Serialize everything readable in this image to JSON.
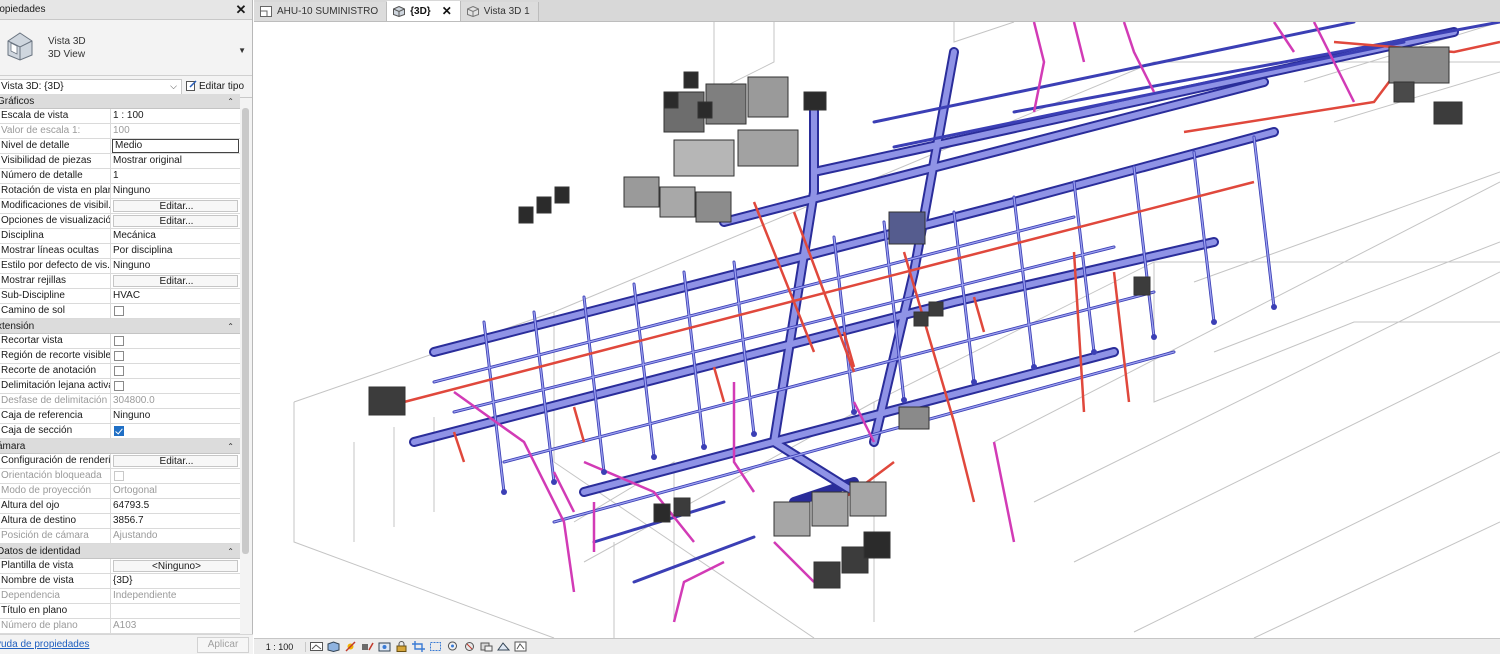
{
  "panel": {
    "title": "ropiedades",
    "type_name_line1": "Vista 3D",
    "type_name_line2": "3D View",
    "selector_value": "Vista 3D: {3D}",
    "edit_type_label": "Editar tipo",
    "help_link": "yuda de propiedades",
    "apply_label": "Aplicar"
  },
  "categories": {
    "graficos": "Gráficos",
    "extension": "xtensión",
    "camara": "ámara",
    "identidad": "Datos de identidad"
  },
  "rows": {
    "escala_k": "Escala de vista",
    "escala_v": "1 : 100",
    "valor_escala_k": "Valor de escala    1:",
    "valor_escala_v": "100",
    "nivel_k": "Nivel de detalle",
    "nivel_v": "Medio",
    "visibilidad_k": "Visibilidad de piezas",
    "visibilidad_v": "Mostrar original",
    "numero_detalle_k": "Número de detalle",
    "numero_detalle_v": "1",
    "rotacion_k": "Rotación de vista en plano",
    "rotacion_v": "Ninguno",
    "modif_k": "Modificaciones de visibil...",
    "modif_v": "Editar...",
    "opciones_k": "Opciones de visualizació...",
    "opciones_v": "Editar...",
    "disciplina_k": "Disciplina",
    "disciplina_v": "Mecánica",
    "lineas_k": "Mostrar líneas ocultas",
    "lineas_v": "Por disciplina",
    "estilo_k": "Estilo por defecto de vis...",
    "estilo_v": "Ninguno",
    "rejillas_k": "Mostrar rejillas",
    "rejillas_v": "Editar...",
    "subdisc_k": "Sub-Discipline",
    "subdisc_v": "HVAC",
    "camino_k": "Camino de sol",
    "recortar_k": "Recortar vista",
    "region_k": "Región de recorte visible",
    "anotacion_k": "Recorte de anotación",
    "lejana_k": "Delimitación lejana activa",
    "desfase_k": "Desfase de delimitación ...",
    "desfase_v": "304800.0",
    "caja_ref_k": "Caja de referencia",
    "caja_ref_v": "Ninguno",
    "caja_sec_k": "Caja de sección",
    "render_k": "Configuración de renderi...",
    "render_v": "Editar...",
    "orient_k": "Orientación bloqueada",
    "modo_k": "Modo de proyección",
    "modo_v": "Ortogonal",
    "ojo_k": "Altura del ojo",
    "ojo_v": "64793.5",
    "destino_k": "Altura de destino",
    "destino_v": "3856.7",
    "posicion_k": "Posición de cámara",
    "posicion_v": "Ajustando",
    "plantilla_k": "Plantilla de vista",
    "plantilla_v": "<Ninguno>",
    "nombre_k": "Nombre de vista",
    "nombre_v": "{3D}",
    "dependencia_k": "Dependencia",
    "dependencia_v": "Independiente",
    "titulo_k": "Título en plano",
    "titulo_v": "",
    "num_plano_k": "Número de plano",
    "num_plano_v": "A103"
  },
  "tabs": {
    "t1": "AHU-10 SUMINISTRO",
    "t2": "{3D}",
    "t3": "Vista 3D 1"
  },
  "statusbar": {
    "scale": "1 : 100"
  },
  "colors": {
    "duct_blue": "#5a5fd0",
    "duct_outline": "#2a2d9a",
    "pipe_red": "#e0483c",
    "pipe_magenta": "#d23bb6",
    "equipment_gray": "#8c8c8c"
  },
  "icons": [
    "house-3d-icon",
    "close-icon",
    "edit-type-icon",
    "view-cube-icon",
    "view-control-icons"
  ]
}
